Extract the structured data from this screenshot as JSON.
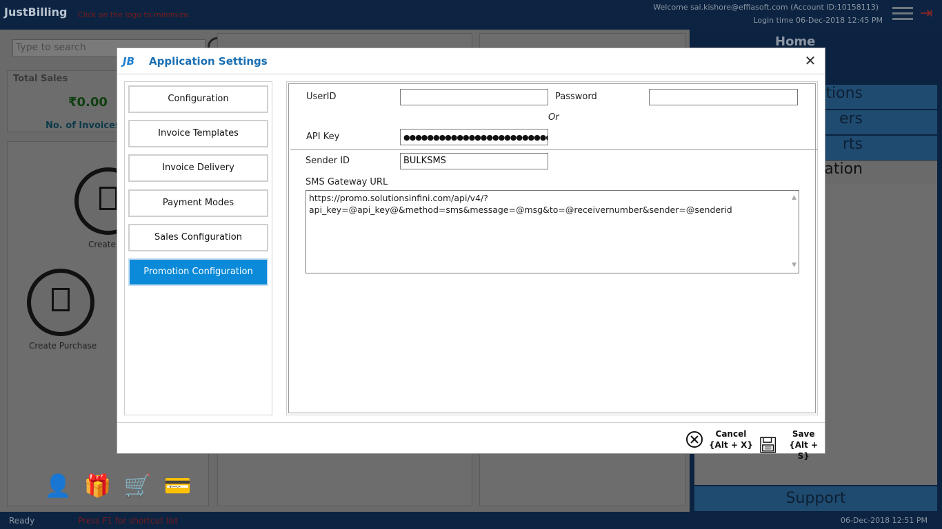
{
  "app": {
    "logo": "JustBilling",
    "logo_hint": "Click on the logo to minimize.",
    "welcome": "Welcome sai.kishore@effiasoft.com (Account ID:10158113)",
    "login_time": "Login time  06-Dec-2018 12:45 PM"
  },
  "dashboard": {
    "search_placeholder": "Type to search",
    "total_sales_label": "Total Sales",
    "total_sales_value": "₹0.00",
    "invoices_label": "No. of Invoices :",
    "create_label": "Create",
    "create_purchase_label": "Create Purchase"
  },
  "side_nav": {
    "home": "Home",
    "items": [
      "tions",
      "ers",
      "rts",
      "ration"
    ],
    "support": "Support"
  },
  "status_bar": {
    "ready": "Ready",
    "hint": "Press F1 for shortcut list",
    "datetime": "06-Dec-2018 12:51 PM"
  },
  "dialog": {
    "icon_text": "JB",
    "title": "Application Settings",
    "menu": [
      {
        "label": "Configuration"
      },
      {
        "label": "Invoice Templates"
      },
      {
        "label": "Invoice Delivery"
      },
      {
        "label": "Payment Modes"
      },
      {
        "label": "Sales Configuration"
      },
      {
        "label": "Promotion Configuration",
        "active": true
      }
    ],
    "form": {
      "userid_label": "UserID",
      "userid_value": "",
      "password_label": "Password",
      "password_value": "",
      "or_text": "Or",
      "apikey_label": "API Key",
      "apikey_value": "●●●●●●●●●●●●●●●●●●●●●●●●●●●●●●",
      "sender_label": "Sender ID",
      "sender_value": "BULKSMS",
      "gateway_label": "SMS Gateway URL",
      "gateway_value": "https://promo.solutionsinfini.com/api/v4/?\napi_key=@api_key@&method=sms&message=@msg&to=@receivernumber&sender=@senderid"
    },
    "footer": {
      "cancel_label": "Cancel",
      "cancel_shortcut": "{Alt + X}",
      "save_label": "Save",
      "save_shortcut": "{Alt + S}"
    }
  }
}
